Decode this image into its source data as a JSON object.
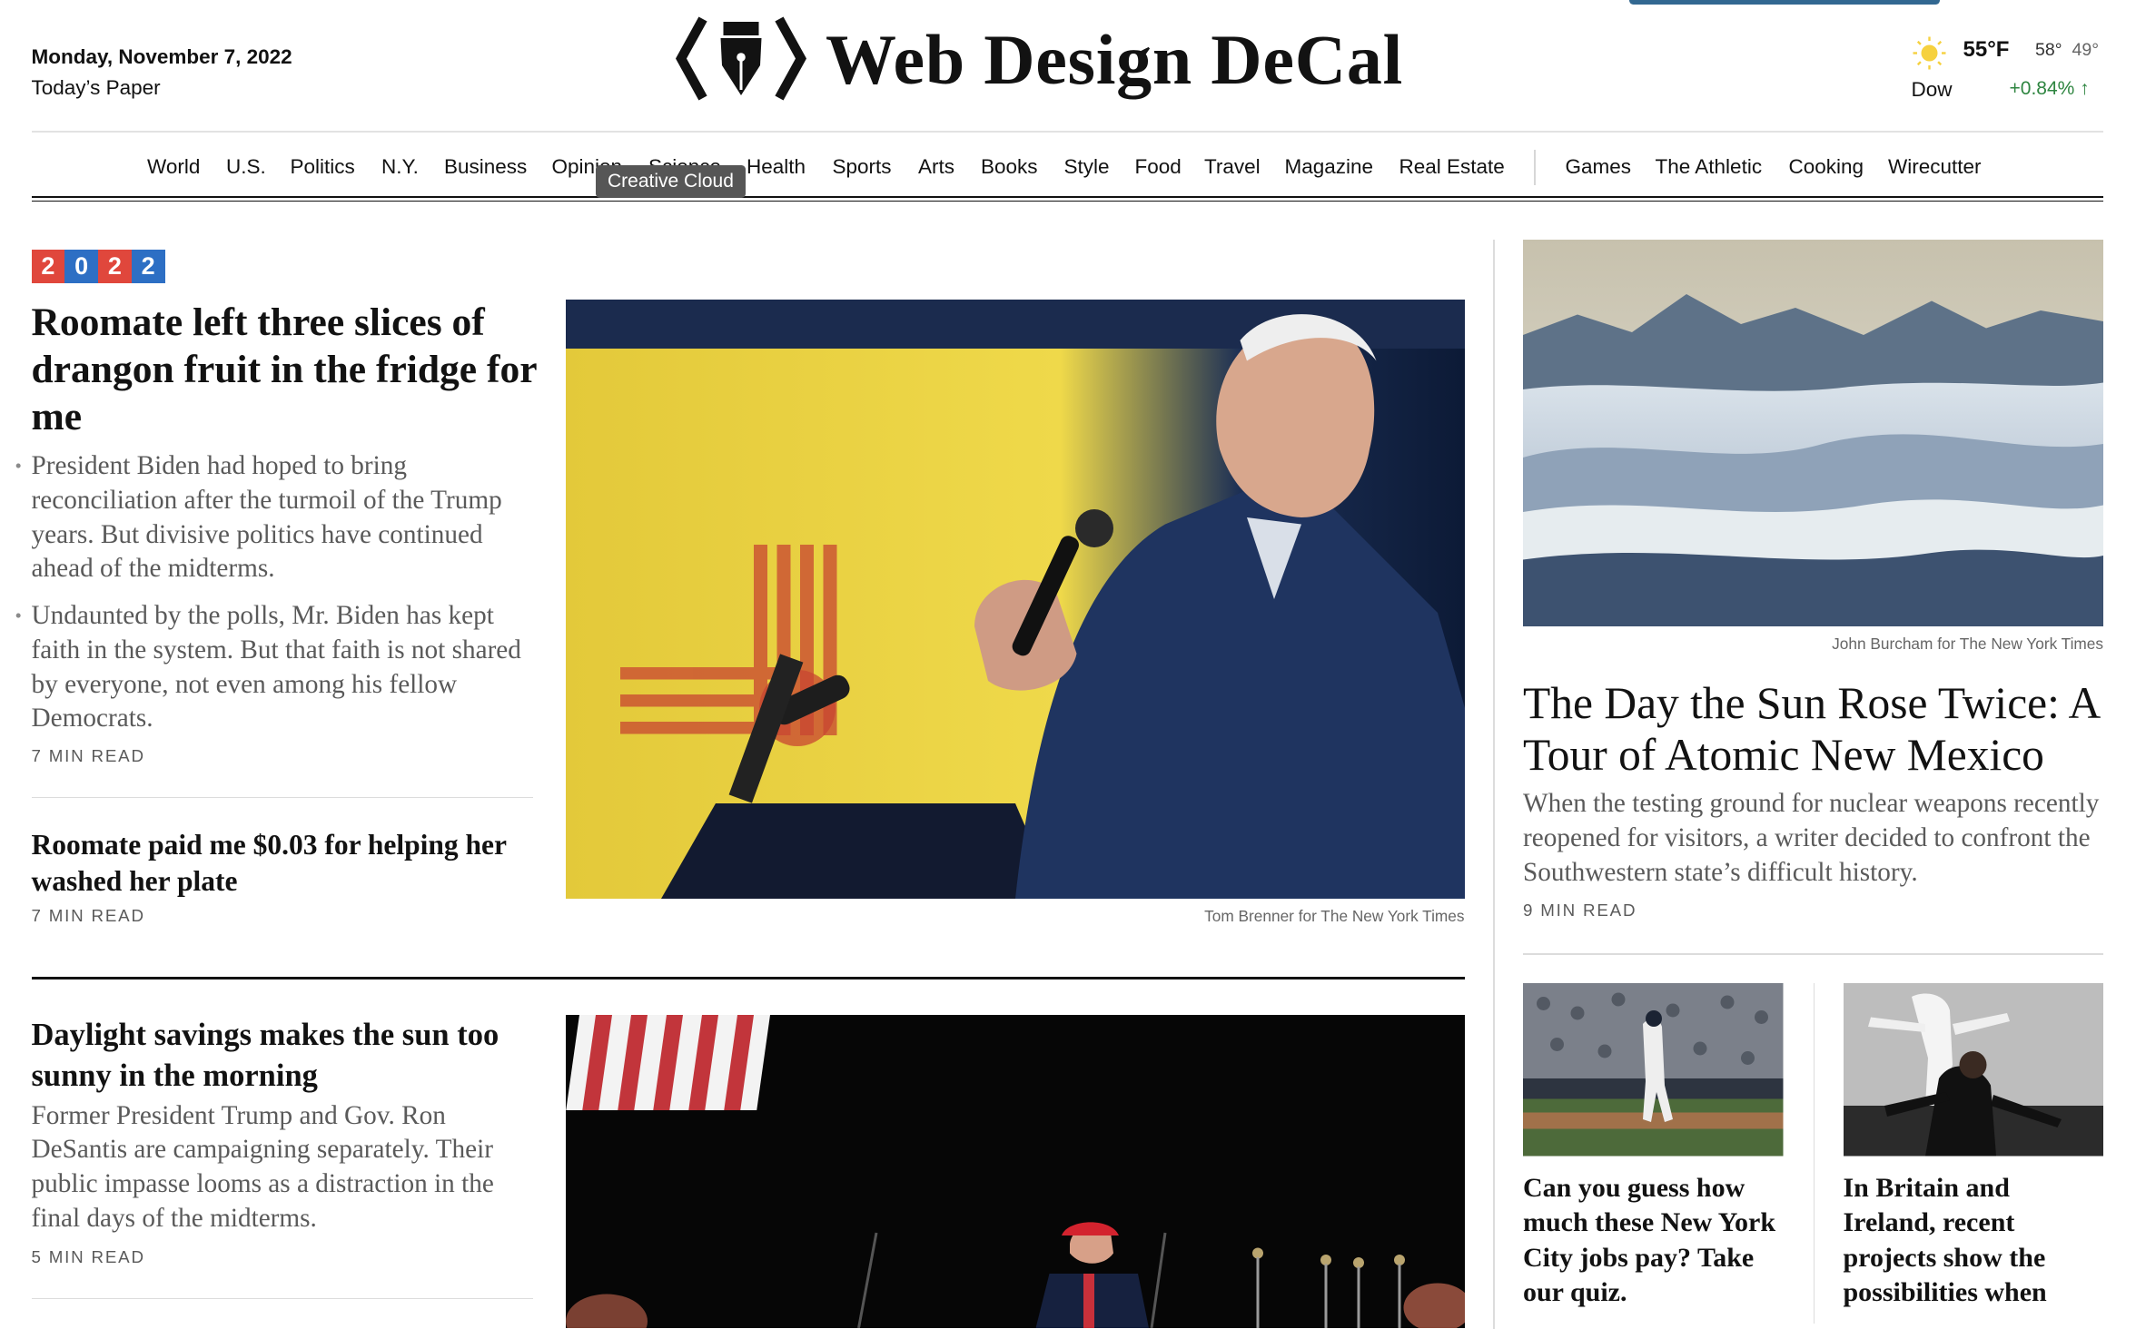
{
  "masthead": {
    "date": "Monday, November 7, 2022",
    "todays_paper": "Today’s Paper",
    "site_title": "Web Design DeCal",
    "logo_icon": "pen-nib-code-brackets-icon"
  },
  "weather": {
    "icon": "sun-icon",
    "temp": "55°F",
    "high": "58°",
    "low": "49°",
    "market_label": "Dow",
    "market_value": "+0.84% ↑",
    "market_color": "#2e8540"
  },
  "nav": {
    "items": [
      "World",
      "U.S.",
      "Politics",
      "N.Y.",
      "Business",
      "Opinion",
      "Science",
      "Health",
      "Sports",
      "Arts",
      "Books",
      "Style",
      "Food",
      "Travel",
      "Magazine",
      "Real Estate"
    ],
    "extras": [
      "Games",
      "The Athletic",
      "Cooking",
      "Wirecutter"
    ],
    "tooltip": "Creative Cloud"
  },
  "badge": {
    "digits": [
      "2",
      "0",
      "2",
      "2"
    ],
    "colors": [
      "#e0473c",
      "#2d6fc4"
    ]
  },
  "lead_story": {
    "headline": "Roomate left three slices of drangon fruit in the fridge for me",
    "summary_1": "President Biden had hoped to bring reconciliation after the turmoil of the Trump years. But divisive politics have continued ahead of the midterms.",
    "summary_2": "Undaunted by the polls, Mr. Biden has kept faith in the system. But that faith is not shared by everyone, not even among his fellow Democrats.",
    "read_time": "7 MIN READ",
    "photo_credit": "Tom Brenner for The New York Times"
  },
  "second_story": {
    "headline": "Roomate paid me $0.03 for helping her washed her plate",
    "read_time": "7 MIN READ"
  },
  "third_story": {
    "headline": "Daylight savings makes the sun too sunny in the morning",
    "summary": "Former President Trump and Gov. Ron DeSantis are campaigning separately. Their public impasse looms as a distraction in the final days of the midterms.",
    "read_time": "5 MIN READ"
  },
  "feature_story": {
    "photo_credit": "John Burcham for The New York Times",
    "headline": "The Day the Sun Rose Twice: A Tour of Atomic New Mexico",
    "summary": "When the testing ground for nuclear weapons recently reopened for visitors, a writer decided to confront the Southwestern state’s difficult history.",
    "read_time": "9 MIN READ"
  },
  "small_stories": [
    {
      "headline": "Can you guess how much these New York City jobs pay? Take our quiz."
    },
    {
      "headline": "In Britain and Ireland, recent projects show the possibilities when"
    }
  ]
}
